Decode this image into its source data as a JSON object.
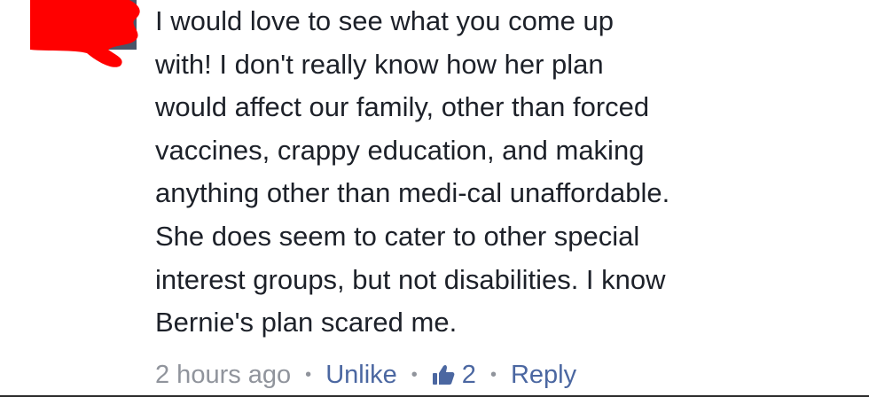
{
  "comment": {
    "lines": [
      "I would love to see what you come up",
      "with! I don't really know how her plan",
      "would affect our family, other than forced",
      "vaccines, crappy education, and making",
      "anything other than medi-cal unaffordable.",
      "She does seem to cater to other special",
      "interest groups, but not disabilities. I know",
      "Bernie's plan scared me."
    ]
  },
  "actions": {
    "timestamp": "2 hours ago",
    "separator": "•",
    "unlike_label": "Unlike",
    "like_icon": "thumbs-up-icon",
    "like_count": "2",
    "reply_label": "Reply"
  },
  "colors": {
    "text": "#1d2129",
    "meta": "#90949c",
    "link": "#4b67a1",
    "redaction": "#ff0000"
  }
}
